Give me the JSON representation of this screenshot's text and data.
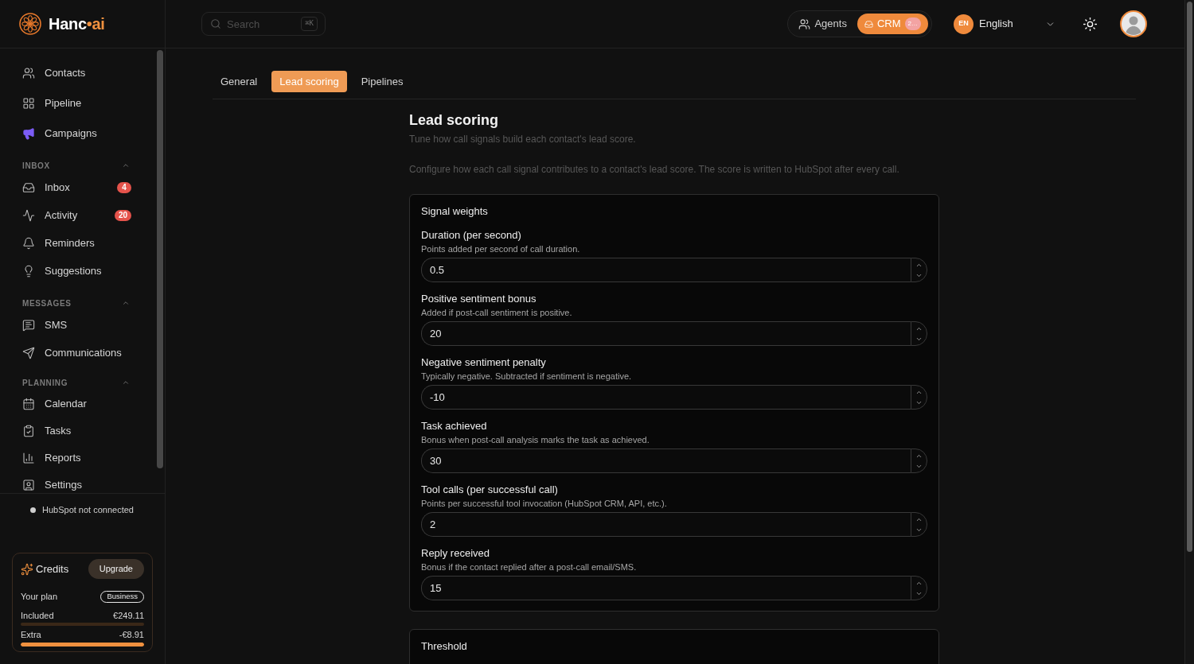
{
  "logo": {
    "text": "Hanc",
    "accent": "•ai"
  },
  "search": {
    "placeholder": "Search",
    "shortcut": "⌘K"
  },
  "view_switcher": [
    {
      "label": "Agents",
      "selected": false
    },
    {
      "label": "CRM",
      "selected": true,
      "badge": "2…"
    }
  ],
  "language": {
    "code": "EN",
    "label": "English"
  },
  "sidebar": {
    "items": [
      {
        "label": "Contacts"
      },
      {
        "label": "Pipeline"
      },
      {
        "label": "Campaigns",
        "color": "#7c5cf6"
      }
    ],
    "sections": [
      {
        "title": "INBOX",
        "expanded": true,
        "items": [
          {
            "label": "Inbox",
            "badge": "4"
          },
          {
            "label": "Activity",
            "badge": "20"
          },
          {
            "label": "Reminders"
          },
          {
            "label": "Suggestions"
          }
        ]
      },
      {
        "title": "MESSAGES",
        "expanded": true,
        "items": [
          {
            "label": "SMS"
          },
          {
            "label": "Communications"
          }
        ]
      },
      {
        "title": "PLANNING",
        "expanded": true,
        "items": [
          {
            "label": "Calendar"
          },
          {
            "label": "Tasks"
          },
          {
            "label": "Reports"
          },
          {
            "label": "Settings"
          }
        ]
      }
    ],
    "status": {
      "text": "HubSpot not connected",
      "connected": false
    }
  },
  "credits": {
    "title": "Credits",
    "upgrade": "Upgrade",
    "plan_label": "Your plan",
    "plan": "Business",
    "rows": [
      {
        "label": "Included",
        "amount": "€249.11",
        "level": 0
      },
      {
        "label": "Extra",
        "amount": "-€8.91",
        "level": 1
      }
    ]
  },
  "tabs": [
    {
      "label": "General",
      "selected": false
    },
    {
      "label": "Lead scoring",
      "selected": true
    },
    {
      "label": "Pipelines",
      "selected": false
    }
  ],
  "page": {
    "title": "Lead scoring",
    "subtitle": "Tune how call signals build each contact's lead score.",
    "description": "Configure how each call signal contributes to a contact's lead score. The score is written to HubSpot after every call."
  },
  "cards": [
    {
      "title": "Signal weights",
      "fields": [
        {
          "label": "Duration (per second)",
          "hint": "Points added per second of call duration.",
          "value": "0.5"
        },
        {
          "label": "Positive sentiment bonus",
          "hint": "Added if post-call sentiment is positive.",
          "value": "20"
        },
        {
          "label": "Negative sentiment penalty",
          "hint": "Typically negative. Subtracted if sentiment is negative.",
          "value": "-10"
        },
        {
          "label": "Task achieved",
          "hint": "Bonus when post-call analysis marks the task as achieved.",
          "value": "30"
        },
        {
          "label": "Tool calls (per successful call)",
          "hint": "Points per successful tool invocation (HubSpot CRM, API, etc.).",
          "value": "2"
        },
        {
          "label": "Reply received",
          "hint": "Bonus if the contact replied after a post-call email/SMS.",
          "value": "15"
        }
      ]
    },
    {
      "title": "Threshold"
    }
  ]
}
